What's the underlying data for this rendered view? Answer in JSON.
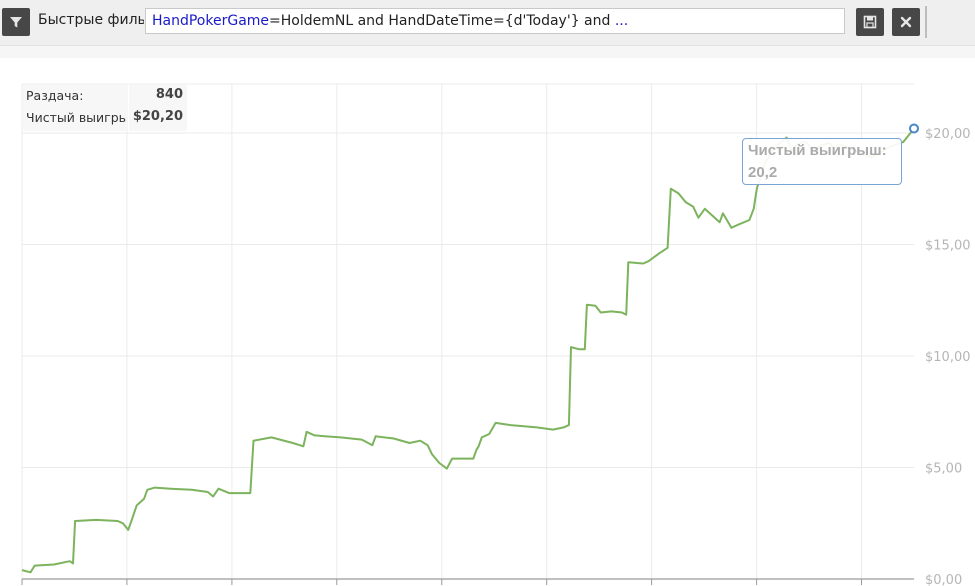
{
  "toolbar": {
    "filter_icon": "filter-icon",
    "label": "Быстрые фильт",
    "query_field": "HandPokerGame",
    "query_rest": "=HoldemNL and HandDateTime={d'Today'} and ",
    "query_more": "...",
    "save_icon": "save-icon",
    "close_icon": "close-icon"
  },
  "stats": {
    "hands_label": "Раздача:",
    "hands_value": "840",
    "net_label": "Чистый выигрь",
    "net_value": "$20,20"
  },
  "tooltip": {
    "label": "Чистый выигрыш:",
    "value": "20,2"
  },
  "colors": {
    "line": "#7cb35d",
    "marker": "#4a86c8",
    "grid": "#ebebeb",
    "axis_text": "#b5b5b5"
  },
  "chart_data": {
    "type": "line",
    "title": "",
    "xlabel": "",
    "ylabel": "",
    "x_range": [
      0,
      840
    ],
    "ylim": [
      0,
      20
    ],
    "y_ticks": [
      0,
      5,
      10,
      15,
      20
    ],
    "y_tick_labels": [
      "$0,00",
      "$5,00",
      "$10,00",
      "$15,00",
      "$20,00"
    ],
    "grid": true,
    "series": [
      {
        "name": "",
        "points": [
          [
            0,
            0.4
          ],
          [
            8,
            0.3
          ],
          [
            12,
            0.6
          ],
          [
            30,
            0.65
          ],
          [
            45,
            0.8
          ],
          [
            48,
            0.7
          ],
          [
            50,
            2.6
          ],
          [
            70,
            2.65
          ],
          [
            90,
            2.6
          ],
          [
            95,
            2.5
          ],
          [
            100,
            2.2
          ],
          [
            103,
            2.6
          ],
          [
            108,
            3.3
          ],
          [
            115,
            3.6
          ],
          [
            118,
            4.0
          ],
          [
            125,
            4.1
          ],
          [
            140,
            4.05
          ],
          [
            160,
            4.0
          ],
          [
            175,
            3.9
          ],
          [
            180,
            3.7
          ],
          [
            185,
            4.05
          ],
          [
            195,
            3.85
          ],
          [
            215,
            3.85
          ],
          [
            218,
            6.2
          ],
          [
            235,
            6.35
          ],
          [
            255,
            6.1
          ],
          [
            265,
            5.95
          ],
          [
            268,
            6.6
          ],
          [
            275,
            6.45
          ],
          [
            285,
            6.4
          ],
          [
            300,
            6.35
          ],
          [
            320,
            6.25
          ],
          [
            330,
            6.0
          ],
          [
            333,
            6.4
          ],
          [
            350,
            6.3
          ],
          [
            365,
            6.1
          ],
          [
            375,
            6.2
          ],
          [
            382,
            6.0
          ],
          [
            386,
            5.6
          ],
          [
            393,
            5.2
          ],
          [
            400,
            4.95
          ],
          [
            405,
            5.4
          ],
          [
            425,
            5.4
          ],
          [
            428,
            5.8
          ],
          [
            430,
            5.95
          ],
          [
            433,
            6.35
          ],
          [
            440,
            6.5
          ],
          [
            446,
            7.0
          ],
          [
            460,
            6.9
          ],
          [
            485,
            6.8
          ],
          [
            500,
            6.7
          ],
          [
            510,
            6.8
          ],
          [
            515,
            6.9
          ],
          [
            517,
            10.4
          ],
          [
            525,
            10.3
          ],
          [
            530,
            10.3
          ],
          [
            532,
            12.3
          ],
          [
            540,
            12.25
          ],
          [
            545,
            11.95
          ],
          [
            555,
            12.0
          ],
          [
            565,
            11.95
          ],
          [
            569,
            11.85
          ],
          [
            571,
            14.2
          ],
          [
            585,
            14.15
          ],
          [
            590,
            14.25
          ],
          [
            600,
            14.6
          ],
          [
            608,
            14.85
          ],
          [
            611,
            17.5
          ],
          [
            618,
            17.3
          ],
          [
            625,
            16.9
          ],
          [
            632,
            16.7
          ],
          [
            637,
            16.2
          ],
          [
            643,
            16.6
          ],
          [
            650,
            16.3
          ],
          [
            657,
            16.0
          ],
          [
            660,
            16.4
          ],
          [
            668,
            15.75
          ],
          [
            675,
            15.9
          ],
          [
            685,
            16.1
          ],
          [
            689,
            16.6
          ],
          [
            692,
            17.5
          ],
          [
            700,
            18.7
          ],
          [
            710,
            19.4
          ],
          [
            720,
            19.8
          ],
          [
            725,
            19.2
          ],
          [
            730,
            19.5
          ],
          [
            738,
            19.6
          ],
          [
            745,
            19.2
          ],
          [
            752,
            19.45
          ],
          [
            760,
            19.55
          ],
          [
            765,
            19.3
          ],
          [
            770,
            19.5
          ],
          [
            800,
            18.9
          ],
          [
            818,
            19.4
          ],
          [
            830,
            19.6
          ],
          [
            840,
            20.2
          ]
        ]
      }
    ]
  }
}
